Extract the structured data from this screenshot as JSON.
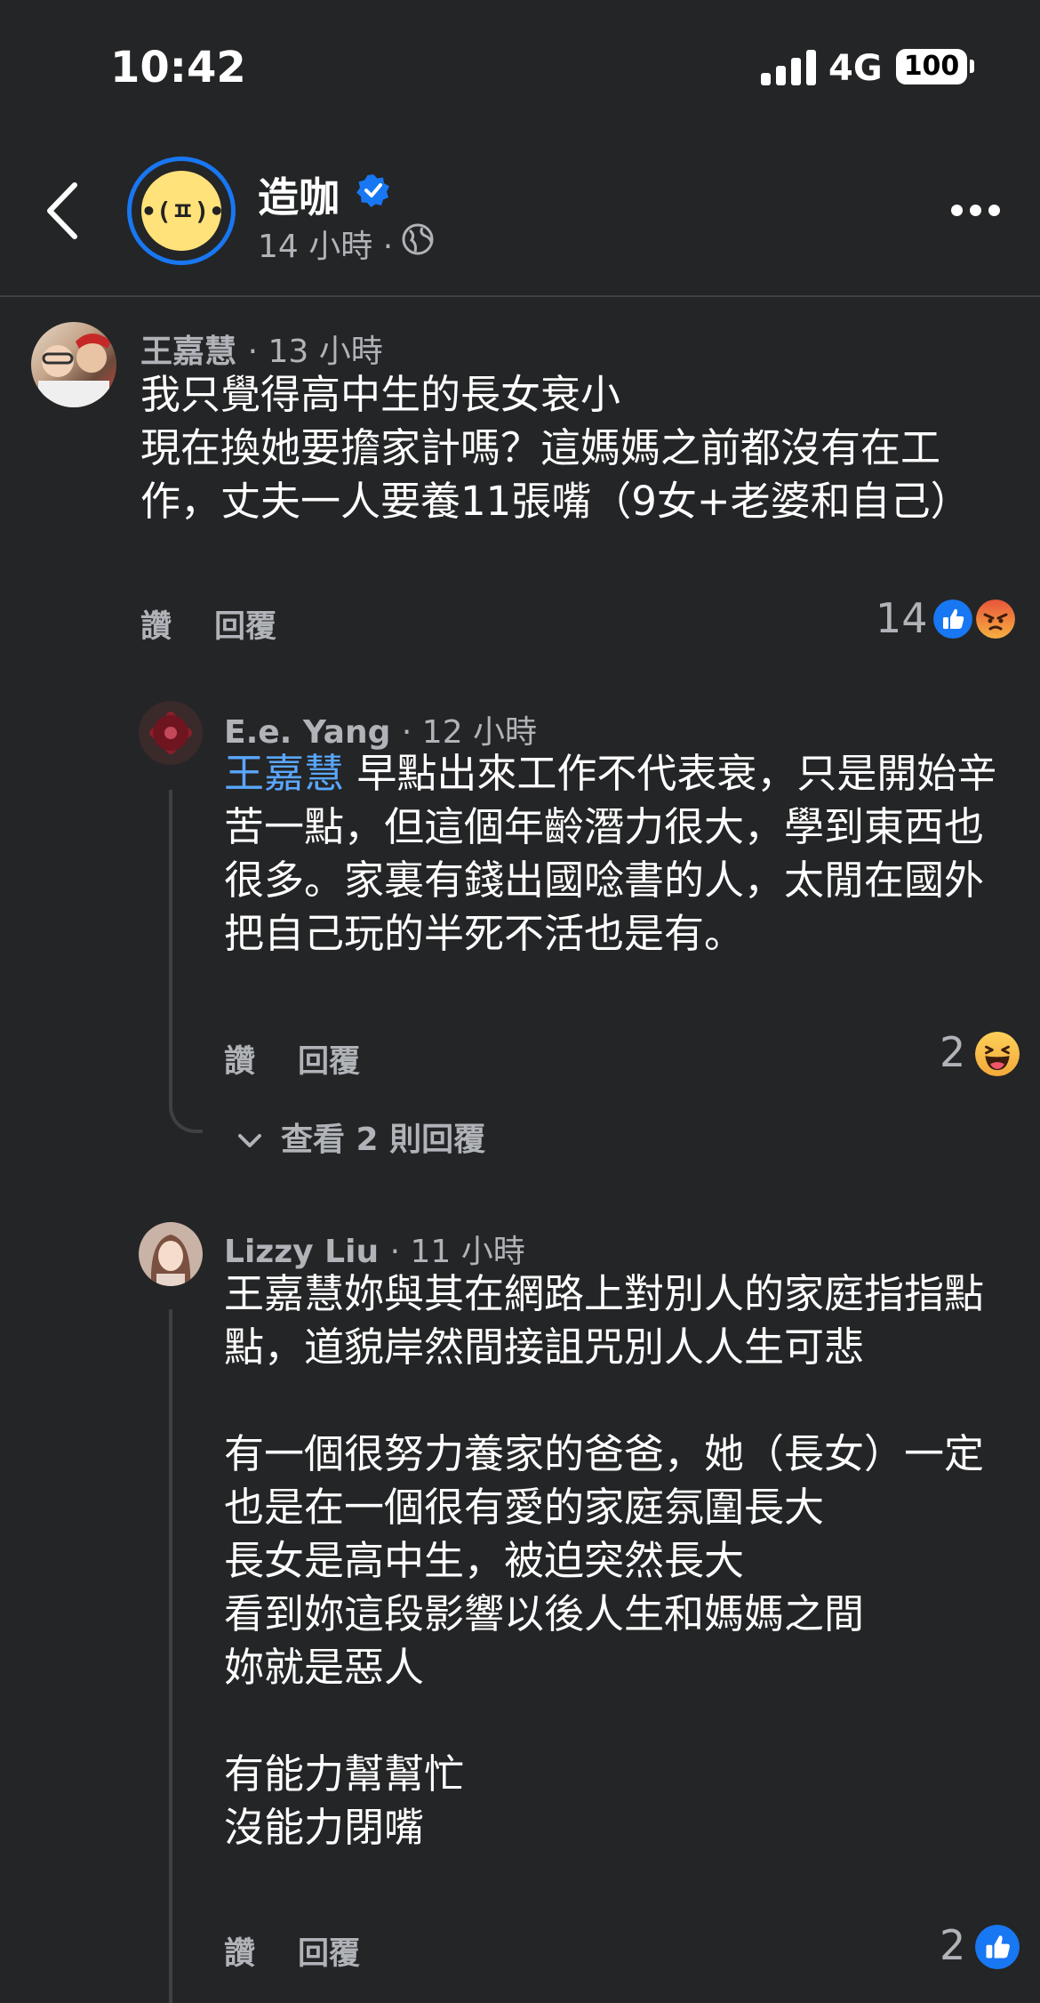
{
  "status_bar": {
    "time": "10:42",
    "network": "4G",
    "battery": "100"
  },
  "header": {
    "page_name": "造咖",
    "meta": "14 小時 ·"
  },
  "comments": [
    {
      "author": "王嘉慧",
      "time": "· 13 小時",
      "text": "我只覺得高中生的長女衰小\n現在換她要擔家計嗎？這媽媽之前都沒有在工作，丈夫一人要養11張嘴（9女+老婆和自己）",
      "like_label": "讚",
      "reply_label": "回覆",
      "reaction_count": "14",
      "reactions": [
        "like-icon",
        "angry-icon"
      ]
    }
  ],
  "replies": [
    {
      "author": "E.e. Yang",
      "time": "· 12 小時",
      "mention": "王嘉慧",
      "text": " 早點出來工作不代表衰，只是開始辛苦一點，但這個年齡潛力很大，學到東西也很多。家裏有錢出國唸書的人，太閒在國外把自己玩的半死不活也是有。",
      "like_label": "讚",
      "reply_label": "回覆",
      "reaction_count": "2",
      "reactions": [
        "haha-icon"
      ],
      "view_more": "查看 2 則回覆"
    },
    {
      "author": "Lizzy Liu",
      "time": "· 11 小時",
      "text": "王嘉慧妳與其在網路上對別人的家庭指指點點，道貌岸然間接詛咒別人人生可悲\n\n有一個很努力養家的爸爸，她（長女）一定也是在一個很有愛的家庭氛圍長大\n長女是高中生，被迫突然長大\n看到妳這段影響以後人生和媽媽之間\n妳就是惡人\n\n有能力幫幫忙\n沒能力閉嘴",
      "like_label": "讚",
      "reply_label": "回覆",
      "reaction_count": "2",
      "reactions": [
        "like-icon"
      ]
    }
  ],
  "colors": {
    "background": "#242526",
    "accent": "#1877f2",
    "mention": "#5aa7ff",
    "secondary_text": "#b0b3b8"
  }
}
